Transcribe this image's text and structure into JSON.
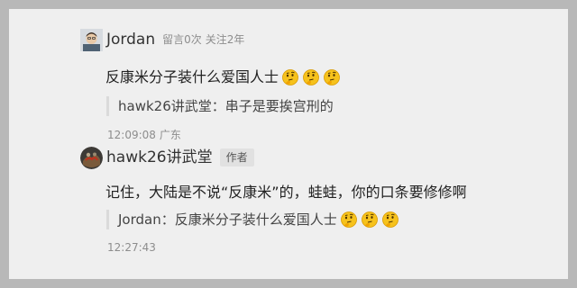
{
  "comments": [
    {
      "username": "Jordan",
      "meta_replies": "留言0次",
      "meta_follow": "关注2年",
      "text": "反康米分子装什么爱国人士",
      "emojis": [
        "thinking-emoji",
        "thinking-emoji",
        "thinking-emoji"
      ],
      "quote": {
        "text": "hawk26讲武堂：串子是要挨宫刑的"
      },
      "time": "12:09:08",
      "location": "广东"
    },
    {
      "username": "hawk26讲武堂",
      "badge": "作者",
      "text": "记住，大陆是不说“反康米”的，蛙蛙，你的口条要修修啊",
      "quote": {
        "text": "Jordan：反康米分子装什么爱国人士",
        "emojis": [
          "thinking-emoji",
          "thinking-emoji",
          "thinking-emoji"
        ]
      },
      "time": "12:27:43"
    }
  ],
  "colors": {
    "backdrop": "#b8b8b8",
    "card": "#efefef",
    "meta_text": "#8d8d8d",
    "quote_bar": "#dadada",
    "badge_bg": "#e1e1e1"
  }
}
